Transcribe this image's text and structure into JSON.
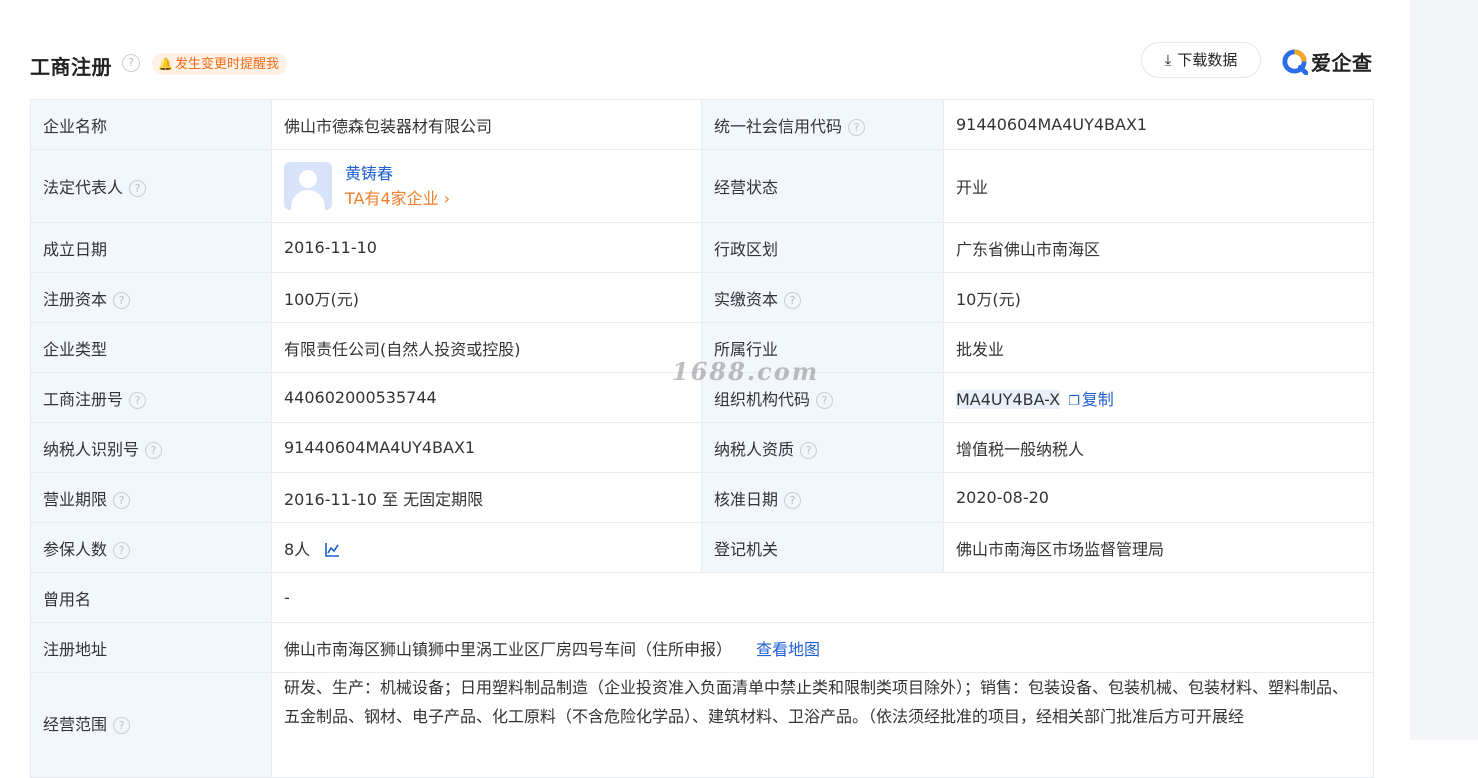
{
  "header": {
    "title": "工商注册",
    "help_glyph": "?",
    "remind_label": "发生变更时提醒我",
    "download_label": "下载数据",
    "brand_name": "爱企查"
  },
  "labels": {
    "company_name": "企业名称",
    "credit_code": "统一社会信用代码",
    "legal_rep": "法定代表人",
    "status": "经营状态",
    "founded": "成立日期",
    "district": "行政区划",
    "reg_capital": "注册资本",
    "paid_capital": "实缴资本",
    "company_type": "企业类型",
    "industry": "所属行业",
    "reg_number": "工商注册号",
    "org_code": "组织机构代码",
    "taxpayer_id": "纳税人识别号",
    "taxpayer_qual": "纳税人资质",
    "term": "营业期限",
    "approval_date": "核准日期",
    "insured": "参保人数",
    "authority": "登记机关",
    "former_name": "曾用名",
    "address": "注册地址",
    "scope": "经营范围"
  },
  "values": {
    "company_name": "佛山市德森包装器材有限公司",
    "credit_code": "91440604MA4UY4BAX1",
    "legal_rep_name": "黄铸春",
    "legal_rep_companies": "TA有4家企业",
    "status": "开业",
    "founded": "2016-11-10",
    "district": "广东省佛山市南海区",
    "reg_capital": "100万(元)",
    "paid_capital": "10万(元)",
    "company_type": "有限责任公司(自然人投资或控股)",
    "industry": "批发业",
    "reg_number": "440602000535744",
    "org_code": "MA4UY4BA-X",
    "copy_label": "复制",
    "taxpayer_id": "91440604MA4UY4BAX1",
    "taxpayer_qual": "增值税一般纳税人",
    "term": "2016-11-10 至 无固定期限",
    "approval_date": "2020-08-20",
    "insured": "8人",
    "authority": "佛山市南海区市场监督管理局",
    "former_name": "-",
    "address": "佛山市南海区狮山镇狮中里涡工业区厂房四号车间（住所申报）",
    "map_link": "查看地图",
    "scope": "研发、生产：机械设备；日用塑料制品制造（企业投资准入负面清单中禁止类和限制类项目除外）；销售：包装设备、包装机械、包装材料、塑料制品、五金制品、钢材、电子产品、化工原料（不含危险化学品）、建筑材料、卫浴产品。（依法须经批准的项目，经相关部门批准后方可开展经"
  },
  "watermark": "1688.com",
  "colors": {
    "label_bg": "#f2f6fd",
    "border": "#e8ecf2",
    "link": "#1e5fd1",
    "accent_orange": "#f07f2c",
    "remind_bg": "#fff1e6"
  },
  "icons": [
    "help-icon",
    "bell-icon",
    "download-icon",
    "brand-logo-icon",
    "avatar-icon",
    "chevron-right-icon",
    "copy-icon",
    "trend-chart-icon"
  ]
}
